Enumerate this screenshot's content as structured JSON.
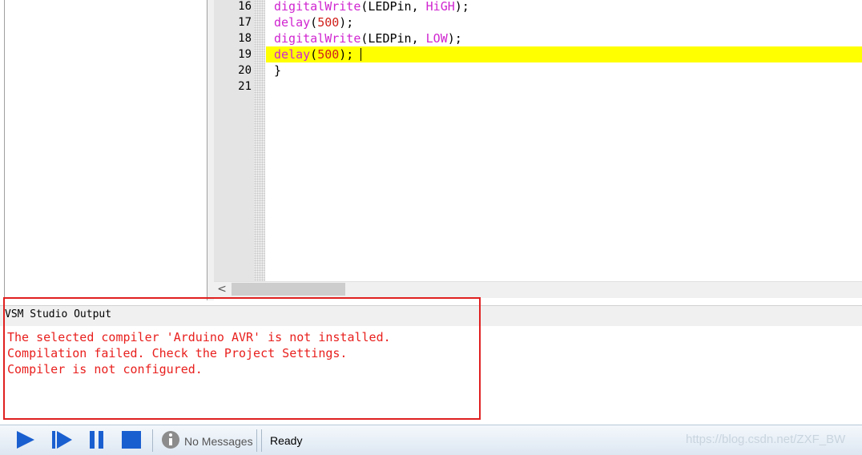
{
  "editor": {
    "lines": [
      {
        "num": "16",
        "parts": {
          "fn": "digitalWrite",
          "a": "(LEDPin, ",
          "b": "HiGH",
          "c": ");"
        }
      },
      {
        "num": "17",
        "parts": {
          "fn": "delay",
          "a": "(",
          "b": "500",
          "c": ");"
        }
      },
      {
        "num": "18",
        "parts": {
          "fn": "digitalWrite",
          "a": "(LEDPin, ",
          "b": "LOW",
          "c": ");"
        }
      },
      {
        "num": "19",
        "parts": {
          "fn": "delay",
          "a": "(",
          "b": "500",
          "c": ");"
        }
      },
      {
        "num": "20",
        "parts": {
          "fn": "",
          "a": "}",
          "b": "",
          "c": ""
        }
      },
      {
        "num": "21",
        "parts": {
          "fn": "",
          "a": "",
          "b": "",
          "c": ""
        }
      }
    ],
    "highlight_color": "#ffff00",
    "function_color": "#d025d0",
    "number_color": "#d0201b"
  },
  "scrollbar": {
    "left_arrow": "<"
  },
  "output": {
    "title": "VSM Studio Output",
    "messages": [
      "The selected compiler 'Arduino AVR' is not installed.",
      "Compilation failed. Check the Project Settings.",
      "Compiler is not configured."
    ],
    "error_color": "#e8201e"
  },
  "toolbar": {
    "play_icon": "play-icon",
    "step_icon": "step-icon",
    "pause_icon": "pause-icon",
    "stop_icon": "stop-icon",
    "info_icon": "info-icon",
    "messages_label": "No Messages",
    "status": "Ready",
    "accent": "#1a5fd0"
  },
  "watermark": "https://blog.csdn.net/ZXF_BW"
}
